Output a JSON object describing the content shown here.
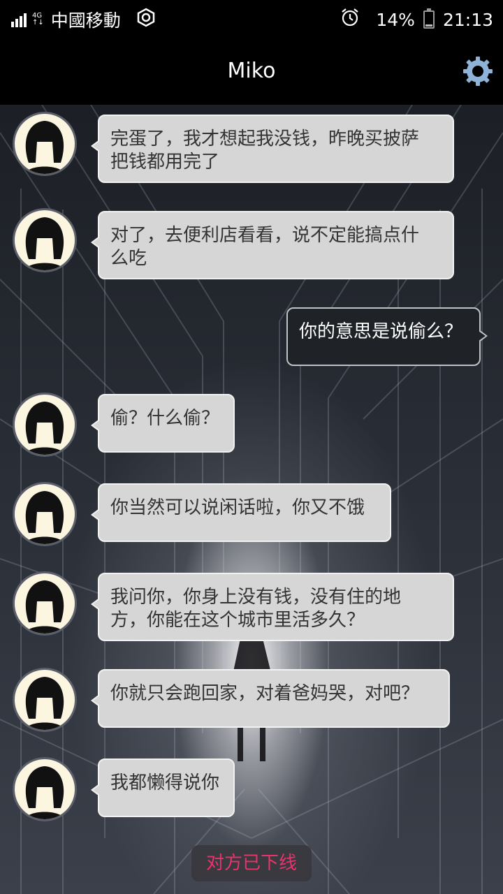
{
  "status_bar": {
    "network": "4G",
    "carrier": "中國移動",
    "battery": "14%",
    "battery_level": 0.14,
    "time": "21:13"
  },
  "header": {
    "title": "Miko",
    "settings_icon": "gear-icon"
  },
  "messages": [
    {
      "from": "Miko",
      "text": "完蛋了，我才想起我没钱，昨晚买披萨\n把钱都用完了"
    },
    {
      "from": "Miko",
      "text": "对了，去便利店看看，说不定能搞点什\n么吃"
    },
    {
      "from": "me",
      "text": "你的意思是说偷么？"
    },
    {
      "from": "Miko",
      "text": "偷？什么偷？"
    },
    {
      "from": "Miko",
      "text": "你当然可以说闲话啦，你又不饿"
    },
    {
      "from": "Miko",
      "text": "我问你，你身上没有钱，没有住的地\n方，你能在这个城市里活多久？"
    },
    {
      "from": "Miko",
      "text": "你就只会跑回家，对着爸妈哭，对吧？"
    },
    {
      "from": "Miko",
      "text": "我都懒得说你"
    }
  ],
  "offline_notice": "对方已下线",
  "colors": {
    "offline_text": "#e8336b",
    "incoming_bubble": "#d6d6d6",
    "outgoing_bubble": "#1f2328",
    "accent_gear": "#8fb2d8"
  }
}
